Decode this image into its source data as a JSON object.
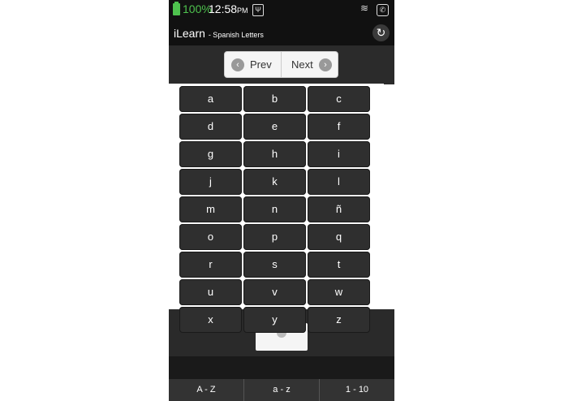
{
  "status": {
    "battery": "100%",
    "time": "12:58",
    "ampm": "PM",
    "usb_glyph": "Ψ",
    "wifi_glyph": "≋",
    "signal_glyph": "✆"
  },
  "header": {
    "app_name": "iLearn",
    "subtitle": "- Spanish Letters",
    "refresh_glyph": "↻"
  },
  "nav": {
    "prev": "Prev",
    "next": "Next",
    "prev_glyph": "‹",
    "next_glyph": "›"
  },
  "letters": [
    "a",
    "b",
    "c",
    "d",
    "e",
    "f",
    "g",
    "h",
    "i",
    "j",
    "k",
    "l",
    "m",
    "n",
    "ñ",
    "o",
    "p",
    "q",
    "r",
    "s",
    "t",
    "u",
    "v",
    "w",
    "x",
    "y",
    "z"
  ],
  "tabs": [
    "A - Z",
    "a - z",
    "1 - 10"
  ]
}
